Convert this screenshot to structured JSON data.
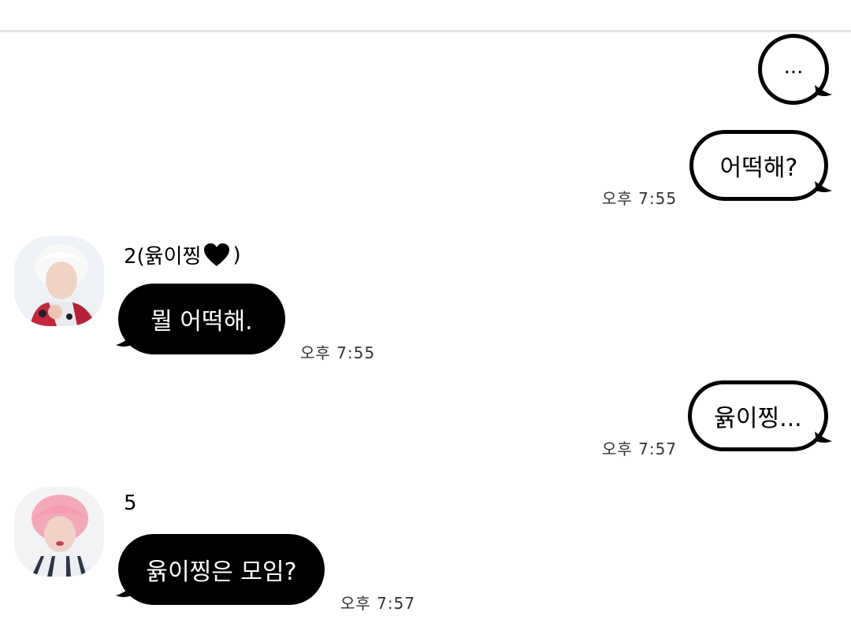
{
  "conversation": {
    "messages": [
      {
        "direction": "outgoing",
        "text": "...",
        "time": ""
      },
      {
        "direction": "outgoing",
        "text": "어떡해?",
        "time": "오후 7:55"
      },
      {
        "direction": "incoming",
        "sender": "2(윩이찡",
        "sender_suffix": ")",
        "text": "뭘 어떡해.",
        "time": "오후 7:55"
      },
      {
        "direction": "outgoing",
        "text": "윩이찡...",
        "time": "오후 7:57"
      },
      {
        "direction": "incoming",
        "sender": "5",
        "text": "윩이찡은 모임?",
        "time": "오후 7:57"
      }
    ]
  },
  "icons": {
    "sender_heart": "heart-icon"
  },
  "colors": {
    "outgoing_bubble_bg": "#ffffff",
    "outgoing_bubble_border": "#000000",
    "incoming_bubble_bg": "#000000",
    "incoming_text": "#ffffff",
    "divider": "#e2e2e2"
  }
}
